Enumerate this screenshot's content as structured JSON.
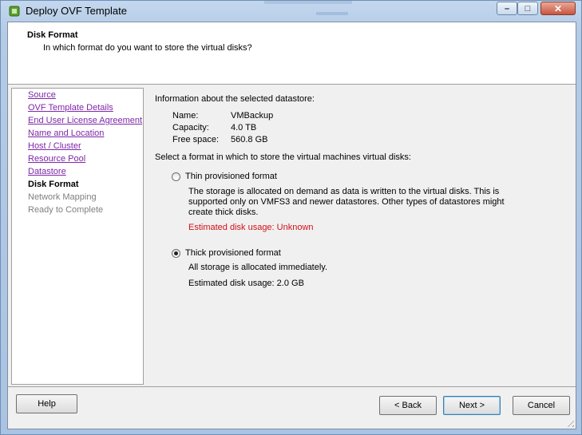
{
  "window": {
    "title": "Deploy OVF Template",
    "minimize_glyph": "–",
    "maximize_glyph": "□",
    "close_glyph": "✕"
  },
  "header": {
    "title": "Disk Format",
    "subtitle": "In which format do you want to store the virtual disks?"
  },
  "nav": {
    "items": [
      {
        "label": "Source",
        "state": "link"
      },
      {
        "label": "OVF Template Details",
        "state": "link"
      },
      {
        "label": "End User License Agreement",
        "state": "link"
      },
      {
        "label": "Name and Location",
        "state": "link"
      },
      {
        "label": "Host / Cluster",
        "state": "link"
      },
      {
        "label": "Resource Pool",
        "state": "link"
      },
      {
        "label": "Datastore",
        "state": "link"
      },
      {
        "label": "Disk Format",
        "state": "current"
      },
      {
        "label": "Network Mapping",
        "state": "disabled"
      },
      {
        "label": "Ready to Complete",
        "state": "disabled"
      }
    ]
  },
  "datastore": {
    "heading": "Information about the selected datastore:",
    "name_label": "Name:",
    "name_value": "VMBackup",
    "capacity_label": "Capacity:",
    "capacity_value": "4.0 TB",
    "free_label": "Free space:",
    "free_value": "560.8 GB"
  },
  "format": {
    "prompt": "Select a format in which to store the virtual machines virtual disks:",
    "thin": {
      "label": "Thin provisioned format",
      "checked": false,
      "description": "The storage is allocated on demand as data is written to the virtual disks. This is supported only on VMFS3 and newer datastores. Other types of datastores might create thick disks.",
      "usage": "Estimated disk usage: Unknown"
    },
    "thick": {
      "label": "Thick provisioned format",
      "checked": true,
      "description": "All storage is allocated immediately.",
      "usage": "Estimated disk usage: 2.0 GB"
    }
  },
  "buttons": {
    "help": "Help",
    "back": "< Back",
    "next": "Next >",
    "cancel": "Cancel"
  },
  "colors": {
    "link": "#7e26a8",
    "warning": "#d0111b",
    "disabled": "#808080"
  }
}
